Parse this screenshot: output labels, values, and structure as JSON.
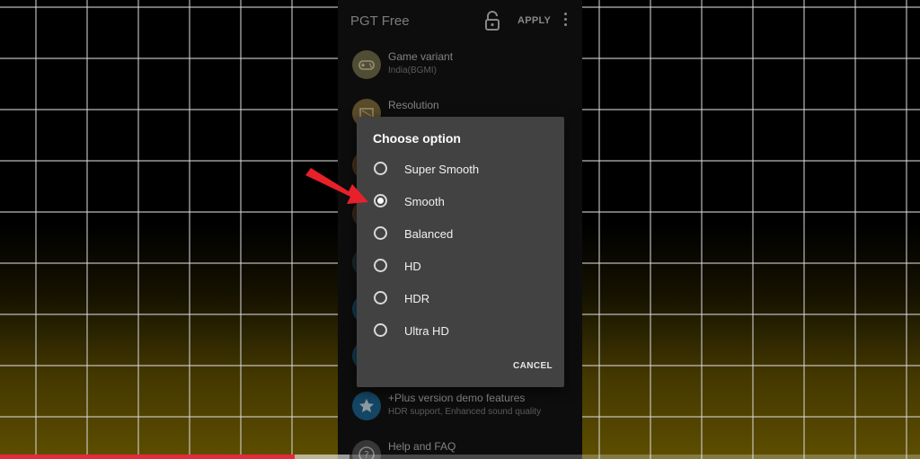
{
  "app": {
    "title": "PGT Free",
    "apply_label": "APPLY"
  },
  "settings": {
    "items": [
      {
        "title": "Game variant",
        "subtitle": "India(BGMI)",
        "icon": "gamepad-icon"
      },
      {
        "title": "Resolution",
        "subtitle": "",
        "icon": "resolution-icon"
      },
      {
        "title": "+Plus version demo features",
        "subtitle": "HDR support, Enhanced sound quality",
        "icon": "star-icon"
      },
      {
        "title": "Help and FAQ",
        "subtitle": "",
        "icon": "help-icon"
      }
    ]
  },
  "dialog": {
    "title": "Choose option",
    "options": [
      {
        "label": "Super Smooth",
        "selected": false
      },
      {
        "label": "Smooth",
        "selected": true
      },
      {
        "label": "Balanced",
        "selected": false
      },
      {
        "label": "HD",
        "selected": false
      },
      {
        "label": "HDR",
        "selected": false
      },
      {
        "label": "Ultra HD",
        "selected": false
      }
    ],
    "cancel_label": "CANCEL"
  },
  "annotation": {
    "arrow_color": "#e8202a",
    "points_to": "Smooth"
  },
  "video_progress": {
    "played_fraction": 0.32,
    "buffered_fraction": 0.38,
    "played_color": "#e52a3a"
  },
  "colors": {
    "grid_line": "#d9d9d9",
    "dialog_bg": "#424242",
    "phone_bg": "#151515"
  }
}
